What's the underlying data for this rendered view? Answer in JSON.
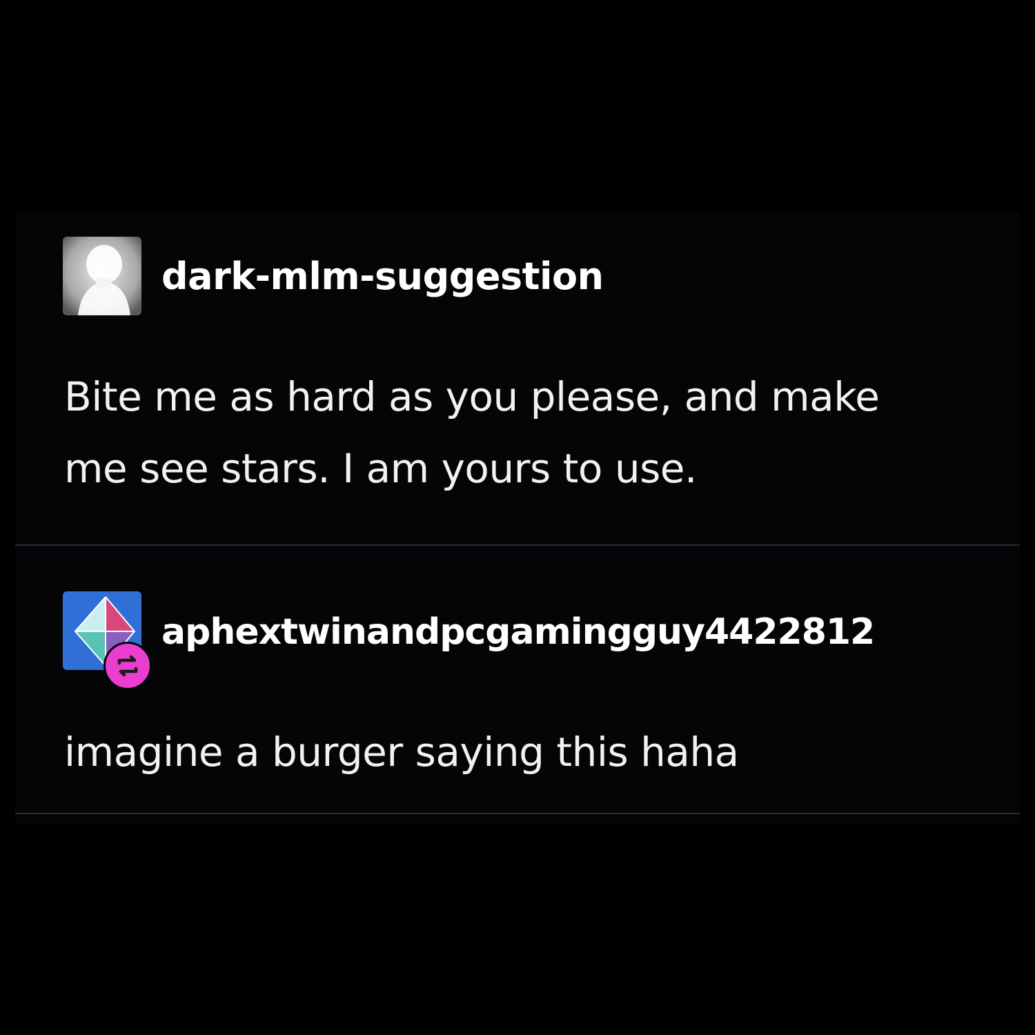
{
  "posts": [
    {
      "username": "dark-mlm-suggestion",
      "avatar_icon": "silhouette-avatar-icon",
      "text": "Bite me as hard as you please, and make me see stars. I am yours to use."
    },
    {
      "username": "aphextwinandpcgamingguy4422812",
      "avatar_icon": "crystal-avatar-icon",
      "badge_icon": "reblog-icon",
      "text": "imagine a burger saying this haha"
    }
  ],
  "colors": {
    "background": "#000000",
    "text": "#f2f2f2",
    "divider": "#2b2d33",
    "reblog_badge": "#e93ecf",
    "avatar_blue": "#2f6fd6"
  }
}
